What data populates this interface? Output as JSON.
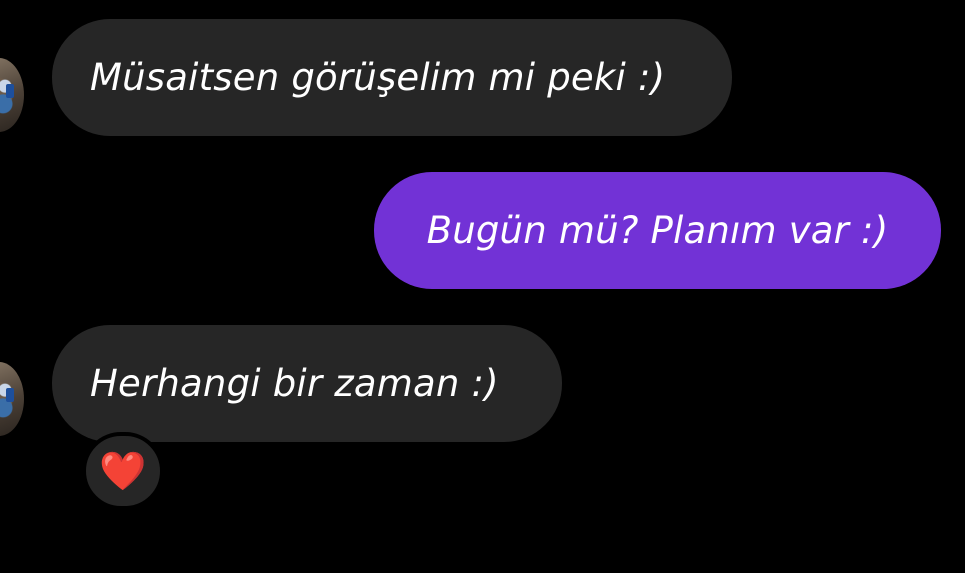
{
  "conversation": {
    "messages": [
      {
        "direction": "incoming",
        "text": "Müsaitsen görüşelim mi peki :)"
      },
      {
        "direction": "outgoing",
        "text": "Bugün mü? Planım var :)"
      },
      {
        "direction": "incoming",
        "text": "Herhangi bir zaman :)"
      }
    ],
    "reaction": {
      "emoji": "❤️",
      "color": "#e11d2e"
    }
  },
  "colors": {
    "background": "#000000",
    "incoming_bubble": "#262626",
    "outgoing_bubble": "#7232d6",
    "text": "#ffffff"
  },
  "icons": [
    "avatar",
    "heart-reaction-icon"
  ]
}
